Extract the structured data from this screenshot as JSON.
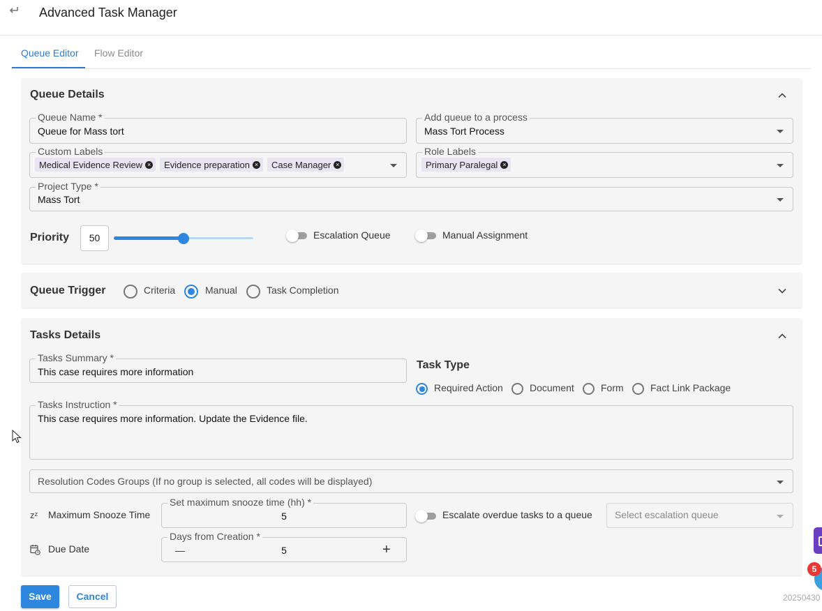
{
  "header": {
    "title": "Advanced Task Manager"
  },
  "tabs": [
    {
      "label": "Queue Editor",
      "active": true
    },
    {
      "label": "Flow Editor",
      "active": false
    }
  ],
  "queue_details": {
    "title": "Queue Details",
    "queue_name": {
      "label": "Queue Name *",
      "value": "Queue for Mass tort"
    },
    "process": {
      "label": "Add queue to a process",
      "value": "Mass Tort Process"
    },
    "custom_labels": {
      "label": "Custom Labels",
      "chips": [
        "Medical Evidence Review",
        "Evidence preparation",
        "Case Manager"
      ]
    },
    "role_labels": {
      "label": "Role Labels",
      "chips": [
        "Primary Paralegal"
      ]
    },
    "project_type": {
      "label": "Project Type *",
      "value": "Mass Tort"
    },
    "priority": {
      "label": "Priority",
      "value": "50",
      "level_percent": 50
    },
    "escalation_queue": {
      "label": "Escalation Queue",
      "on": false
    },
    "manual_assignment": {
      "label": "Manual Assignment",
      "on": false
    }
  },
  "queue_trigger": {
    "title": "Queue Trigger",
    "options": [
      "Criteria",
      "Manual",
      "Task Completion"
    ],
    "selected": "Manual"
  },
  "tasks_details": {
    "title": "Tasks Details",
    "summary": {
      "label": "Tasks Summary *",
      "value": "This case requires more information"
    },
    "task_type": {
      "label": "Task Type",
      "options": [
        "Required Action",
        "Document",
        "Form",
        "Fact Link Package"
      ],
      "selected": "Required Action"
    },
    "instruction": {
      "label": "Tasks Instruction *",
      "value": "This case requires more information. Update the Evidence file."
    },
    "resolution_codes": {
      "placeholder": "Resolution Codes Groups (If no group is selected, all codes will be displayed)"
    },
    "snooze": {
      "row_label": "Maximum Snooze Time",
      "icon_text": "zᶻ",
      "field_label": "Set maximum snooze time (hh) *",
      "value": "5"
    },
    "escalate": {
      "label": "Escalate overdue tasks to a queue",
      "on": false,
      "select_placeholder": "Select escalation queue"
    },
    "due_date": {
      "row_label": "Due Date",
      "field_label": "Days from Creation *",
      "value": "5",
      "minus": "—",
      "plus": "+"
    }
  },
  "footer": {
    "save": "Save",
    "cancel": "Cancel",
    "version": "20250430"
  },
  "floating": {
    "badge_count": "5"
  },
  "colors": {
    "accent": "#2e86de",
    "tab_active": "#2e7bd6",
    "panel_bg": "#f5f5f5",
    "chip_bg": "#e9e4f2",
    "badge": "#e53935"
  }
}
